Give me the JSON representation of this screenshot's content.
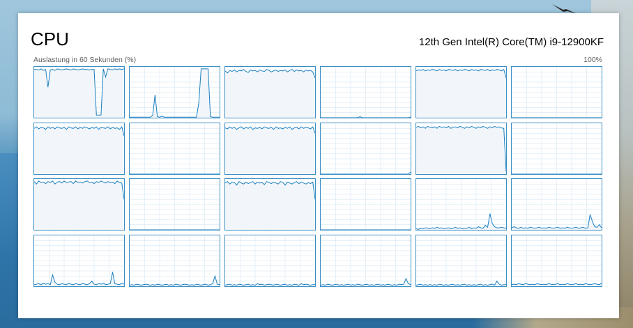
{
  "window": {
    "title": "CPU",
    "cpu_name": "12th Gen Intel(R) Core(TM) i9-12900KF",
    "axis_label": "Auslastung in 60 Sekunden (%)",
    "axis_max": "100%"
  },
  "colors": {
    "accent": "#1a7fc1",
    "grid": "#d6e7f4",
    "fill": "#f1f5fa",
    "border": "#3a8fc6"
  },
  "cores": [
    {
      "id": 0,
      "values": [
        95,
        95,
        94,
        96,
        93,
        95,
        60,
        94,
        95,
        93,
        96,
        95,
        94,
        95,
        96,
        95,
        94,
        96,
        95,
        94,
        95,
        96,
        95,
        95,
        94,
        95,
        95,
        5,
        5,
        5,
        96,
        80,
        96,
        95,
        94,
        96,
        95,
        96,
        95,
        96
      ]
    },
    {
      "id": 1,
      "values": [
        1,
        1,
        1,
        1,
        1,
        1,
        1,
        1,
        1,
        1,
        5,
        45,
        2,
        1,
        3,
        1,
        1,
        1,
        1,
        1,
        1,
        1,
        1,
        1,
        1,
        1,
        1,
        1,
        1,
        1,
        30,
        96,
        96,
        96,
        96,
        2,
        1,
        1,
        1,
        1
      ]
    },
    {
      "id": 2,
      "values": [
        92,
        88,
        93,
        91,
        94,
        90,
        93,
        92,
        95,
        91,
        89,
        94,
        92,
        93,
        90,
        94,
        92,
        91,
        95,
        93,
        90,
        92,
        94,
        91,
        93,
        92,
        94,
        90,
        93,
        95,
        91,
        94,
        92,
        93,
        90,
        94,
        92,
        93,
        90,
        78
      ]
    },
    {
      "id": 3,
      "values": [
        0,
        0,
        0,
        0,
        0,
        0,
        0,
        0,
        0,
        0,
        0,
        0,
        0,
        0,
        0,
        0,
        0,
        2,
        0,
        0,
        0,
        0,
        0,
        0,
        0,
        0,
        0,
        0,
        0,
        0,
        0,
        0,
        0,
        0,
        0,
        0,
        0,
        0,
        0,
        1
      ]
    },
    {
      "id": 4,
      "values": [
        92,
        94,
        93,
        95,
        92,
        94,
        93,
        95,
        94,
        92,
        95,
        93,
        94,
        92,
        95,
        94,
        93,
        95,
        92,
        94,
        93,
        95,
        94,
        92,
        95,
        93,
        94,
        92,
        95,
        94,
        93,
        95,
        92,
        94,
        93,
        95,
        94,
        92,
        95,
        78
      ]
    },
    {
      "id": 5,
      "values": [
        0,
        0,
        0,
        0,
        0,
        0,
        0,
        0,
        0,
        0,
        0,
        0,
        0,
        0,
        0,
        0,
        0,
        0,
        0,
        0,
        0,
        0,
        0,
        0,
        0,
        0,
        0,
        0,
        0,
        0,
        0,
        0,
        0,
        0,
        0,
        0,
        0,
        0,
        0,
        0
      ]
    },
    {
      "id": 6,
      "values": [
        90,
        93,
        89,
        92,
        91,
        88,
        93,
        90,
        92,
        89,
        93,
        91,
        90,
        92,
        88,
        93,
        91,
        90,
        93,
        89,
        92,
        90,
        93,
        91,
        89,
        92,
        90,
        93,
        88,
        92,
        91,
        90,
        93,
        89,
        92,
        90,
        91,
        88,
        93,
        75
      ]
    },
    {
      "id": 7,
      "values": [
        0,
        0,
        0,
        0,
        0,
        0,
        0,
        0,
        0,
        0,
        0,
        0,
        0,
        0,
        0,
        0,
        0,
        0,
        0,
        0,
        0,
        0,
        0,
        0,
        0,
        0,
        0,
        0,
        0,
        0,
        0,
        0,
        0,
        0,
        0,
        0,
        0,
        0,
        0,
        0
      ]
    },
    {
      "id": 8,
      "values": [
        91,
        89,
        93,
        90,
        92,
        88,
        91,
        93,
        89,
        92,
        90,
        93,
        88,
        91,
        90,
        92,
        89,
        93,
        91,
        90,
        92,
        88,
        93,
        90,
        91,
        89,
        92,
        90,
        93,
        88,
        91,
        92,
        89,
        93,
        90,
        92,
        91,
        89,
        93,
        80
      ]
    },
    {
      "id": 9,
      "values": [
        0,
        0,
        0,
        0,
        0,
        0,
        0,
        0,
        0,
        0,
        0,
        0,
        0,
        0,
        0,
        0,
        0,
        0,
        0,
        0,
        0,
        0,
        0,
        0,
        0,
        0,
        0,
        0,
        0,
        0,
        0,
        0,
        0,
        0,
        0,
        0,
        0,
        0,
        0,
        4
      ]
    },
    {
      "id": 10,
      "values": [
        92,
        94,
        91,
        93,
        90,
        94,
        92,
        91,
        93,
        90,
        94,
        92,
        93,
        91,
        94,
        90,
        92,
        93,
        91,
        94,
        92,
        90,
        93,
        91,
        94,
        92,
        90,
        93,
        91,
        94,
        92,
        90,
        93,
        91,
        94,
        92,
        93,
        91,
        90,
        5
      ]
    },
    {
      "id": 11,
      "values": [
        0,
        0,
        0,
        0,
        0,
        0,
        0,
        0,
        0,
        0,
        0,
        0,
        0,
        0,
        0,
        0,
        0,
        0,
        0,
        0,
        0,
        0,
        0,
        0,
        0,
        0,
        0,
        0,
        0,
        0,
        0,
        0,
        0,
        0,
        0,
        0,
        0,
        0,
        0,
        0
      ]
    },
    {
      "id": 12,
      "values": [
        95,
        90,
        96,
        93,
        94,
        91,
        95,
        93,
        96,
        90,
        94,
        95,
        92,
        96,
        93,
        94,
        95,
        91,
        96,
        93,
        94,
        92,
        95,
        96,
        93,
        94,
        91,
        95,
        93,
        96,
        94,
        92,
        95,
        93,
        94,
        91,
        96,
        93,
        92,
        60
      ]
    },
    {
      "id": 13,
      "values": [
        0,
        0,
        0,
        0,
        0,
        0,
        0,
        0,
        0,
        0,
        0,
        0,
        0,
        0,
        0,
        0,
        0,
        0,
        0,
        0,
        0,
        0,
        0,
        0,
        0,
        0,
        0,
        0,
        0,
        0,
        0,
        0,
        0,
        0,
        0,
        0,
        0,
        0,
        0,
        0
      ]
    },
    {
      "id": 14,
      "values": [
        92,
        95,
        90,
        94,
        93,
        88,
        95,
        92,
        90,
        94,
        91,
        93,
        95,
        90,
        94,
        92,
        93,
        89,
        95,
        93,
        91,
        94,
        92,
        90,
        95,
        93,
        88,
        94,
        92,
        90,
        93,
        95,
        91,
        94,
        92,
        90,
        93,
        91,
        94,
        60
      ]
    },
    {
      "id": 15,
      "values": [
        0,
        0,
        0,
        0,
        0,
        0,
        0,
        0,
        0,
        0,
        0,
        0,
        0,
        0,
        0,
        0,
        0,
        0,
        0,
        0,
        0,
        0,
        0,
        0,
        0,
        0,
        0,
        0,
        0,
        0,
        0,
        0,
        0,
        0,
        0,
        0,
        0,
        0,
        0,
        0
      ]
    },
    {
      "id": 16,
      "values": [
        2,
        1,
        3,
        2,
        4,
        3,
        2,
        4,
        3,
        5,
        3,
        4,
        2,
        3,
        4,
        2,
        3,
        5,
        3,
        4,
        2,
        3,
        3,
        5,
        2,
        4,
        3,
        6,
        4,
        3,
        9,
        5,
        32,
        12,
        6,
        4,
        4,
        5,
        4,
        3
      ]
    },
    {
      "id": 17,
      "values": [
        4,
        6,
        4,
        3,
        5,
        3,
        4,
        3,
        5,
        4,
        3,
        4,
        5,
        3,
        4,
        3,
        5,
        4,
        3,
        4,
        5,
        3,
        4,
        3,
        5,
        4,
        3,
        4,
        5,
        3,
        4,
        5,
        3,
        4,
        30,
        16,
        6,
        5,
        10,
        4
      ]
    },
    {
      "id": 18,
      "values": [
        3,
        4,
        5,
        3,
        6,
        4,
        5,
        3,
        22,
        8,
        4,
        3,
        5,
        4,
        3,
        6,
        4,
        3,
        5,
        4,
        3,
        6,
        4,
        3,
        5,
        10,
        4,
        3,
        5,
        4,
        6,
        3,
        4,
        5,
        28,
        5,
        4,
        3,
        6,
        4
      ]
    },
    {
      "id": 19,
      "values": [
        2,
        3,
        2,
        4,
        3,
        2,
        3,
        4,
        3,
        2,
        3,
        2,
        4,
        3,
        2,
        3,
        4,
        2,
        3,
        2,
        4,
        3,
        2,
        3,
        4,
        3,
        2,
        3,
        2,
        4,
        3,
        2,
        3,
        4,
        2,
        3,
        5,
        20,
        4,
        3
      ]
    },
    {
      "id": 20,
      "values": [
        2,
        3,
        4,
        2,
        3,
        2,
        4,
        3,
        2,
        3,
        4,
        2,
        3,
        2,
        5,
        3,
        4,
        2,
        3,
        4,
        3,
        2,
        4,
        3,
        2,
        3,
        4,
        2,
        3,
        2,
        4,
        3,
        2,
        5,
        3,
        4,
        3,
        2,
        3,
        3
      ]
    },
    {
      "id": 21,
      "values": [
        2,
        3,
        2,
        4,
        3,
        2,
        3,
        4,
        2,
        3,
        2,
        3,
        4,
        2,
        3,
        2,
        4,
        3,
        2,
        3,
        4,
        2,
        3,
        2,
        3,
        4,
        2,
        3,
        2,
        4,
        3,
        2,
        3,
        2,
        4,
        3,
        4,
        15,
        5,
        3
      ]
    },
    {
      "id": 22,
      "values": [
        2,
        3,
        4,
        2,
        3,
        2,
        3,
        2,
        3,
        2,
        4,
        3,
        2,
        3,
        2,
        3,
        4,
        2,
        3,
        2,
        3,
        4,
        2,
        3,
        2,
        3,
        2,
        3,
        4,
        2,
        3,
        2,
        3,
        4,
        2,
        10,
        4,
        2,
        3,
        3
      ]
    },
    {
      "id": 23,
      "values": [
        3,
        4,
        3,
        5,
        4,
        3,
        5,
        4,
        3,
        4,
        3,
        5,
        4,
        3,
        4,
        3,
        5,
        4,
        3,
        4,
        5,
        3,
        4,
        3,
        5,
        4,
        3,
        4,
        5,
        3,
        4,
        3,
        5,
        4,
        3,
        4,
        5,
        4,
        3,
        6
      ]
    }
  ]
}
